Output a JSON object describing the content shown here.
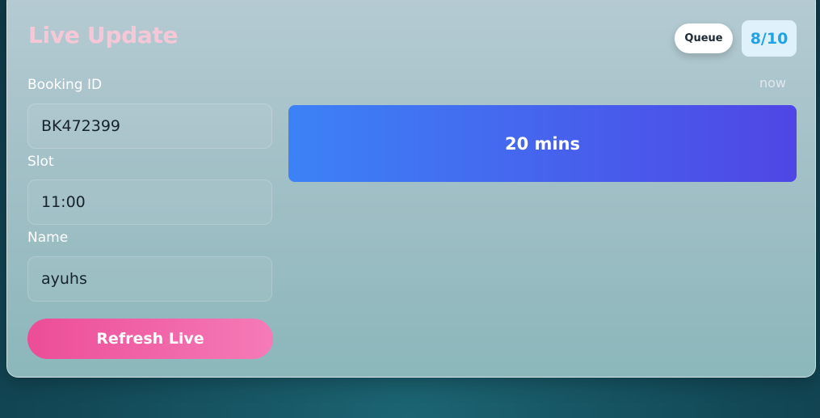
{
  "header": {
    "title": "Live Update",
    "queue_label": "Queue",
    "queue_count": "8/10"
  },
  "form": {
    "booking_id": {
      "label": "Booking ID",
      "value": "BK472399"
    },
    "slot": {
      "label": "Slot",
      "value": "11:00"
    },
    "name": {
      "label": "Name",
      "value": "ayuhs"
    },
    "refresh_label": "Refresh Live"
  },
  "status": {
    "updated": "now",
    "wait_time": "20 mins"
  },
  "colors": {
    "accent_pink": "#ec4d97",
    "title_pink": "#f6c7d6",
    "wait_gradient_start": "#3c82f6",
    "wait_gradient_end": "#4f46e5",
    "badge_text": "#1ea2e8"
  }
}
